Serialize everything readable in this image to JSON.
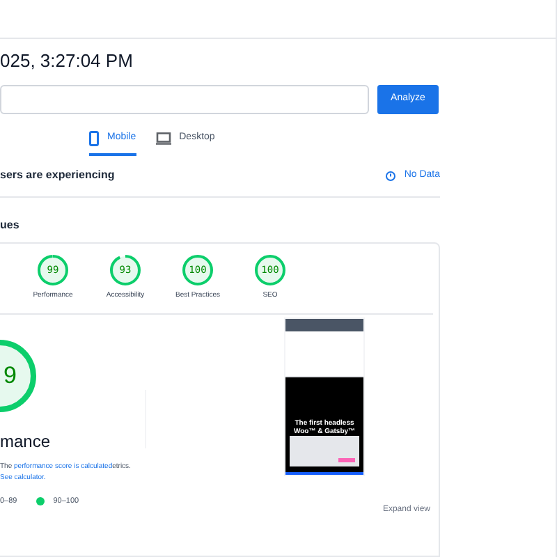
{
  "report_time": "025, 3:27:04 PM",
  "analyze_button": "Analyze",
  "device_tabs": [
    {
      "label": "Mobile",
      "kind": "mobile",
      "selected": true
    },
    {
      "label": "Desktop",
      "kind": "desktop",
      "selected": false
    }
  ],
  "field_data": {
    "heading": "sers are experiencing",
    "status": "No Data"
  },
  "diagnose": {
    "heading": "ues",
    "scores": [
      {
        "score": "99",
        "label": "Performance",
        "level": 0.99
      },
      {
        "score": "93",
        "label": "Accessibility",
        "level": 0.93
      },
      {
        "score": "100",
        "label": "Best Practices",
        "level": 1
      },
      {
        "score": "100",
        "label": "SEO",
        "level": 1
      }
    ]
  },
  "performance": {
    "score": "9",
    "level": 0.99,
    "title": "mance",
    "description": [
      {
        "text": "The ",
        "link": false
      },
      {
        "text": "performance score is calculated",
        "link": true
      },
      {
        "text": "etrics. ",
        "link": false
      },
      {
        "text": "See calculator.",
        "link": true
      }
    ],
    "legend": [
      {
        "range": "0–89"
      },
      {
        "range": "90–100",
        "color": "#0cce6b"
      }
    ]
  },
  "thumbnail": {
    "headline": "The first headless Woo™ & Gatsby™"
  },
  "expand_link": "Expand view"
}
